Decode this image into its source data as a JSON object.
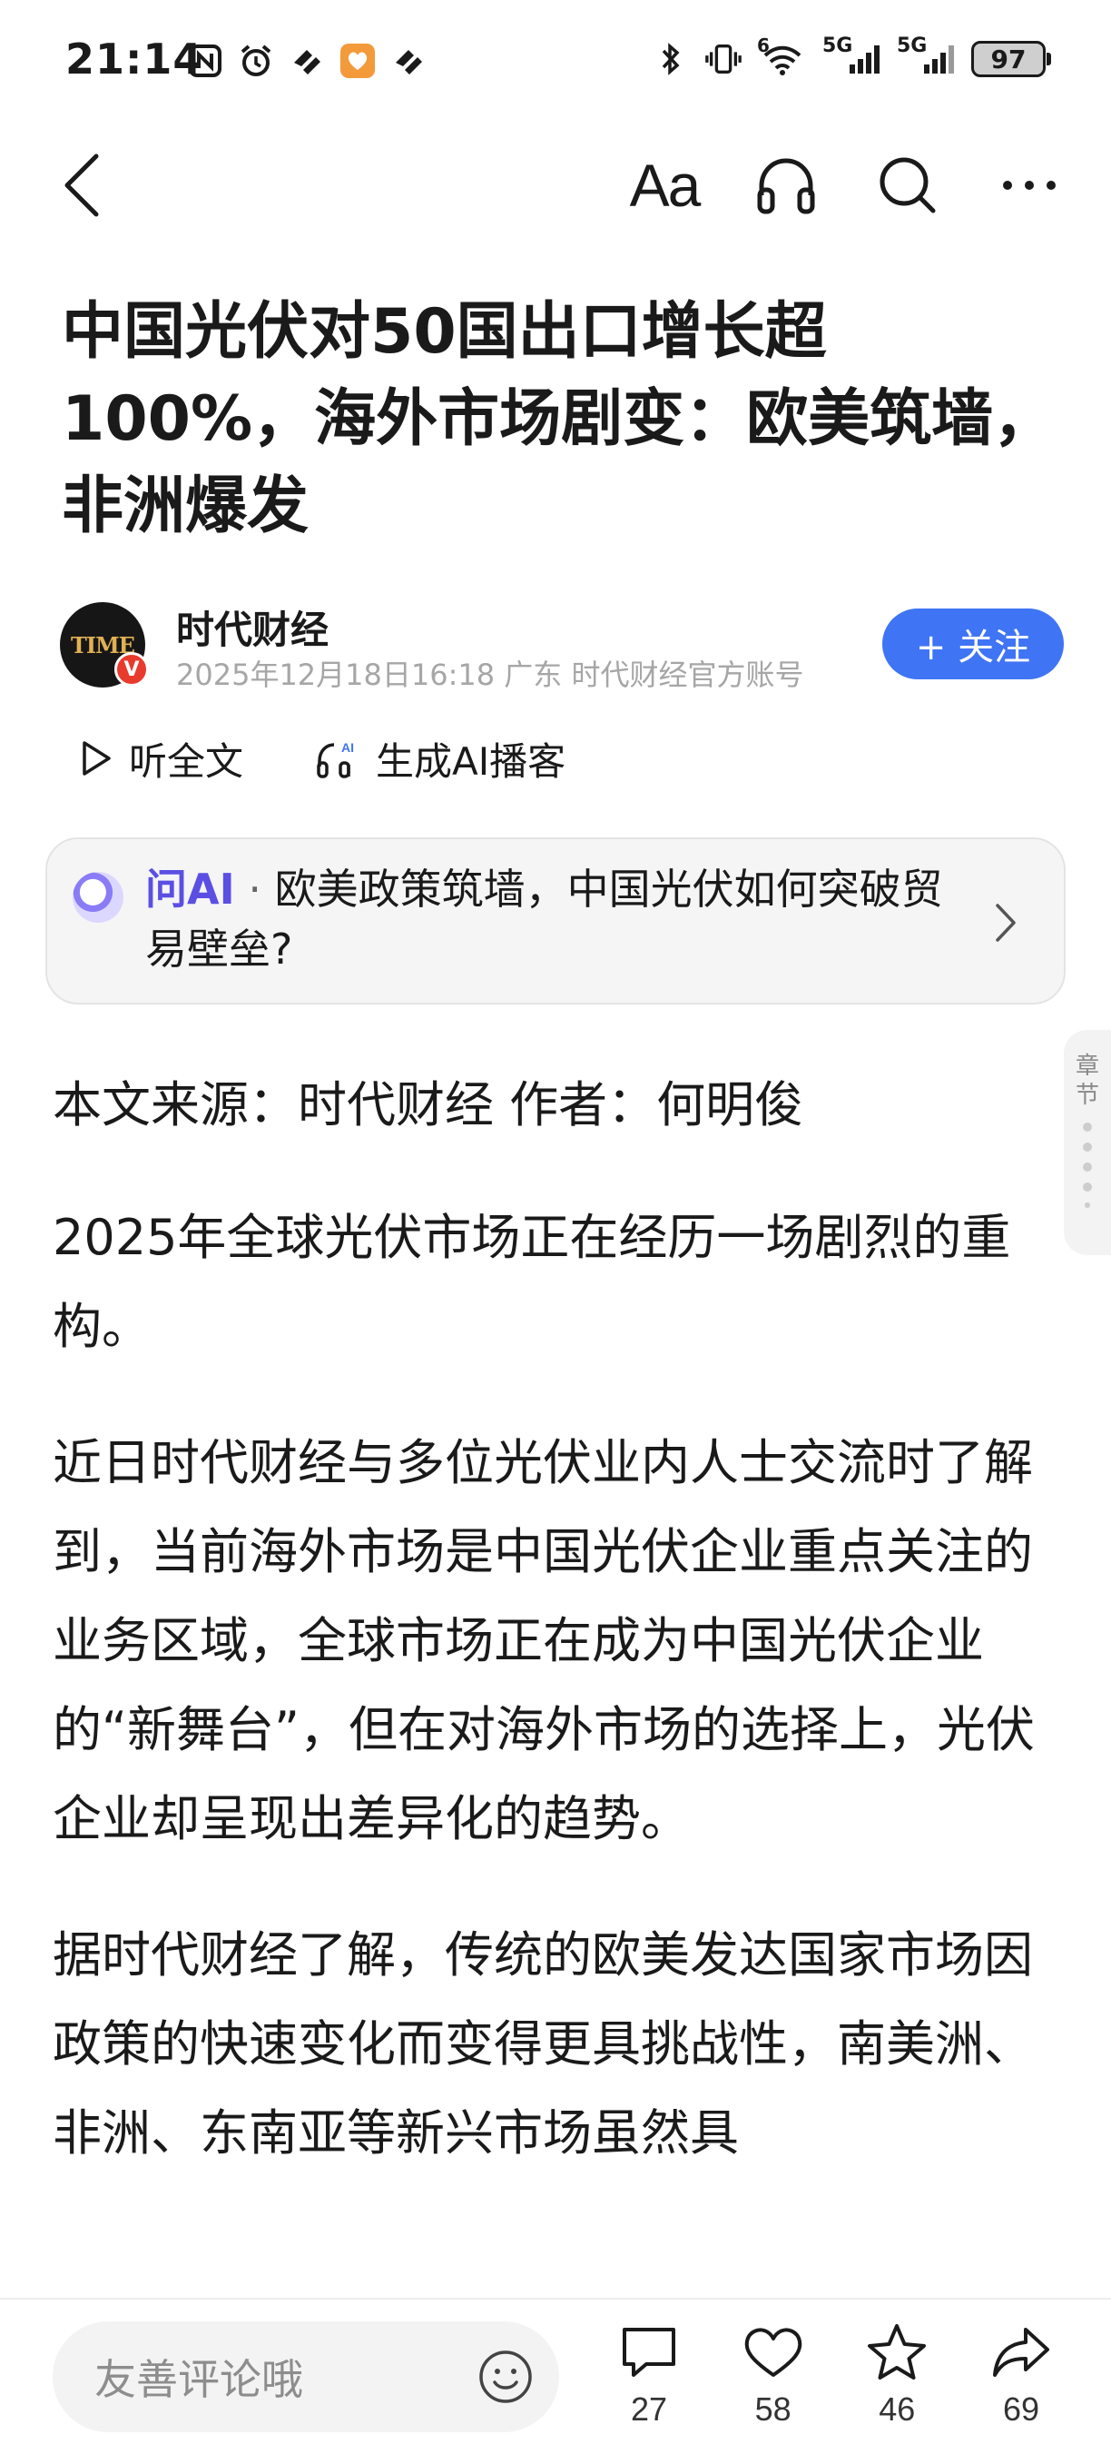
{
  "status_bar": {
    "time": "21:14",
    "left_icons": [
      "nfc-icon",
      "alarm-icon",
      "app-icon",
      "heart-app-icon",
      "app-icon"
    ],
    "right_icons": [
      "bluetooth-icon",
      "vibrate-icon",
      "wifi-icon",
      "signal-5g-icon",
      "signal-5g-icon"
    ],
    "wifi_label": "6",
    "net1_label": "5G",
    "net2_label": "5G",
    "battery": "97"
  },
  "nav": {
    "font_label": "Aa"
  },
  "article": {
    "title": "中国光伏对50国出口增长超100%，海外市场剧变：欧美筑墙，非洲爆发",
    "author": {
      "name": "时代财经",
      "avatar_text": "TIME",
      "badge": "V",
      "meta": "2025年12月18日16:18 广东 时代财经官方账号",
      "follow_label": "+ 关注"
    },
    "listen_label": "听全文",
    "podcast_label": "生成AI播客",
    "ai_card": {
      "brand": "问AI",
      "dot": " · ",
      "question": "欧美政策筑墙，中国光伏如何突破贸易壁垒?"
    },
    "chapter_label": "章节",
    "paragraphs": [
      "本文来源：时代财经 作者：何明俊",
      "2025年全球光伏市场正在经历一场剧烈的重构。",
      "近日时代财经与多位光伏业内人士交流时了解到，当前海外市场是中国光伏企业重点关注的业务区域，全球市场正在成为中国光伏企业的“新舞台”，但在对海外市场的选择上，光伏企业却呈现出差异化的趋势。",
      "据时代财经了解，传统的欧美发达国家市场因政策的快速变化而变得更具挑战性，南美洲、非洲、东南亚等新兴市场虽然具"
    ]
  },
  "bottom_bar": {
    "comment_placeholder": "友善评论哦",
    "comments": "27",
    "likes": "58",
    "favorites": "46",
    "shares": "69"
  },
  "colors": {
    "accent_blue": "#3f74f5",
    "ai_purple": "#5b4fe3",
    "badge_red": "#e93a2e",
    "meta_gray": "#a6a6a6"
  }
}
